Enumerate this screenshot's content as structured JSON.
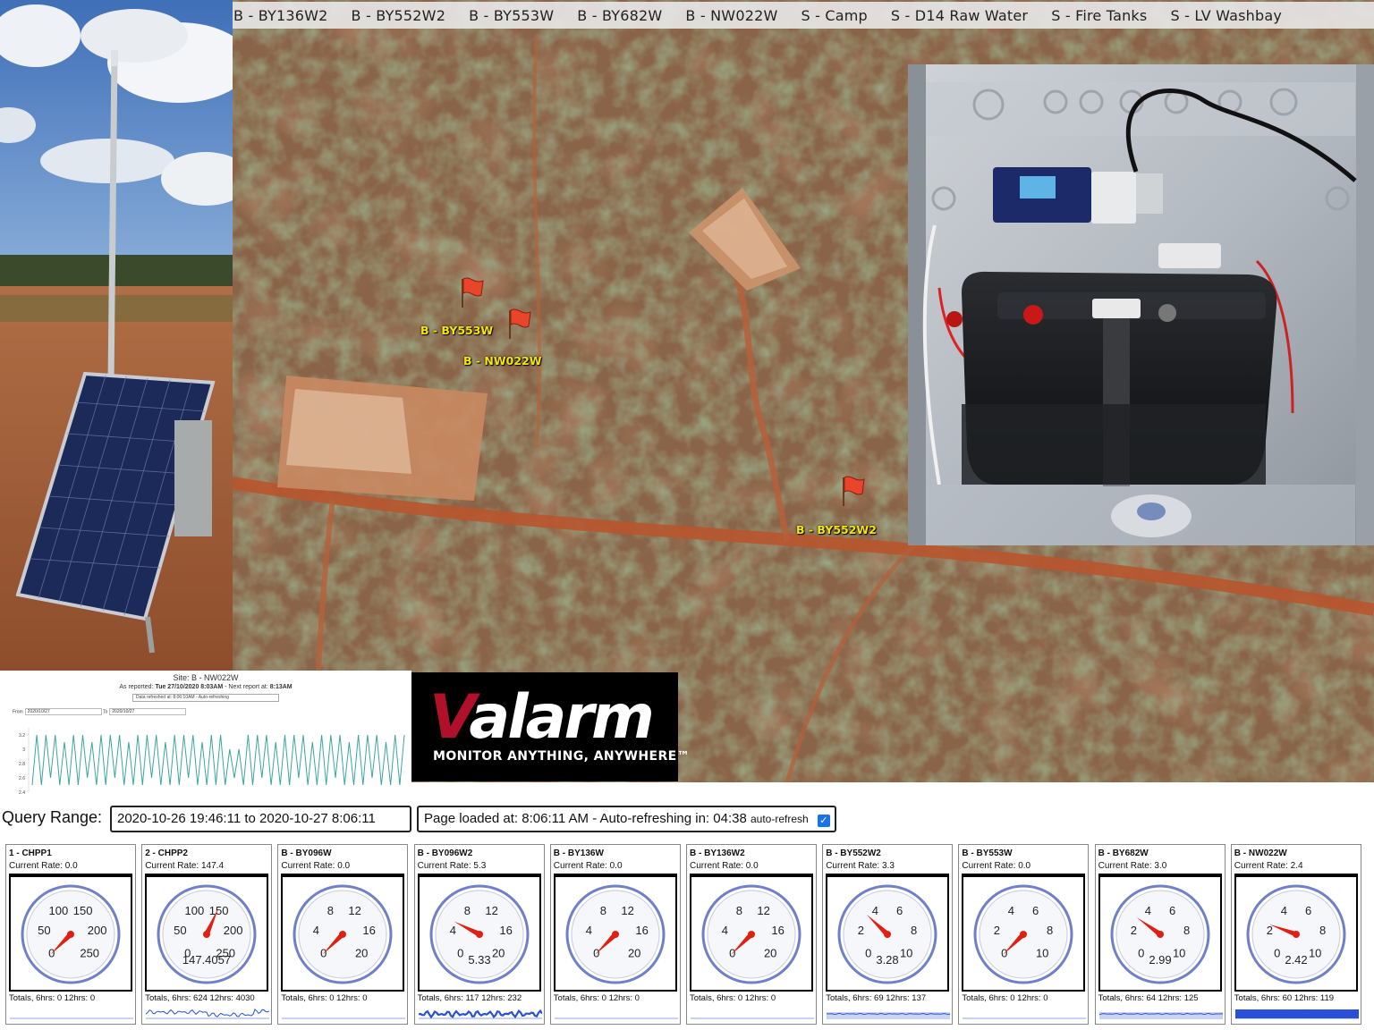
{
  "tabs": [
    "B - BY136W2",
    "B - BY552W2",
    "B - BY553W",
    "B - BY682W",
    "B - NW022W",
    "S - Camp",
    "S - D14 Raw Water",
    "S - Fire Tanks",
    "S - LV Washbay"
  ],
  "map_markers": [
    {
      "label": "B - BY553W"
    },
    {
      "label": "B - NW022W"
    },
    {
      "label": "B - BY552W2"
    }
  ],
  "detail_chart": {
    "site_title": "Site: B - NW022W",
    "reported_prefix": "As reported: ",
    "reported_at": "Tue 27/10/2020 8:03AM",
    "next_prefix": " - Next report at: ",
    "next_at": "8:13AM",
    "refresh_text": "Data refreshed at: 8:06:10AM - Auto-refreshing",
    "from_label": "From",
    "from_value": "2020/10/27",
    "to_label": "To",
    "to_value": "2020/10/27",
    "chart_data": {
      "type": "line",
      "ylim": [
        2.4,
        3.3
      ],
      "y_ticks": [
        "3.2",
        "3",
        "2.8",
        "2.6",
        "2.4"
      ],
      "series": [
        {
          "values": [
            2.5,
            3.2,
            2.5,
            3.2,
            2.6,
            3.2,
            2.5,
            3.1,
            2.5,
            3.2,
            2.5,
            3.2,
            2.6,
            3.1,
            2.5,
            3.2,
            2.5,
            3.2,
            2.6,
            3.2,
            2.5,
            3.1,
            2.5,
            3.2,
            2.5,
            3.2,
            2.6,
            3.2,
            2.5,
            3.1,
            2.5,
            3.2,
            2.5,
            3.2,
            2.6,
            3.2,
            2.5,
            3.1,
            2.5,
            3.2,
            2.5,
            3.2,
            2.5,
            3.0,
            2.6,
            3.0,
            2.5,
            3.2,
            2.5,
            3.2,
            2.6,
            3.2,
            2.5,
            3.1,
            2.5,
            3.2,
            2.5,
            3.2,
            2.6,
            3.2,
            2.5,
            3.1,
            2.5,
            3.2,
            2.5,
            3.2,
            2.6,
            3.2,
            2.5,
            3.1,
            2.5,
            3.2,
            2.5,
            3.2,
            2.6,
            3.2,
            2.5,
            3.1,
            2.5,
            3.2,
            2.5,
            3.2
          ]
        }
      ]
    }
  },
  "logo": {
    "v": "V",
    "rest": "alarm",
    "tagline": "MONITOR ANYTHING, ANYWHERE™"
  },
  "query": {
    "label": "Query Range:",
    "range": "2020-10-26 19:46:11 to 2020-10-27 8:06:11",
    "loaded": "Page loaded at: 8:06:11 AM - Auto-refreshing in: 04:38",
    "auto_refresh_label": "auto-refresh",
    "auto_refresh_checked": true
  },
  "colors": {
    "needle": "#e02010",
    "gauge_ring": "#7080c8",
    "spark": "#2a4fd8",
    "marker_flag": "#e8452a",
    "marker_label": "#f5e60a"
  },
  "gauges": [
    {
      "title": "1 - CHPP1",
      "rate": "Current Rate: 0.0",
      "ticks": [
        "0",
        "50",
        "100",
        "150",
        "200",
        "250"
      ],
      "max": 250,
      "value": 0,
      "readout": "",
      "totals": "Totals, 6hrs: 0 12hrs: 0",
      "spark": "flat"
    },
    {
      "title": "2 - CHPP2",
      "rate": "Current Rate: 147.4",
      "ticks": [
        "0",
        "50",
        "100",
        "150",
        "200",
        "250"
      ],
      "max": 250,
      "value": 147.4057,
      "readout": "147.4057",
      "totals": "Totals, 6hrs: 624 12hrs: 4030",
      "spark": "noisy"
    },
    {
      "title": "B - BY096W",
      "rate": "Current Rate: 0.0",
      "ticks": [
        "0",
        "4",
        "8",
        "12",
        "16",
        "20"
      ],
      "max": 20,
      "value": 0,
      "readout": "",
      "totals": "Totals, 6hrs: 0 12hrs: 0",
      "spark": "flat"
    },
    {
      "title": "B - BY096W2",
      "rate": "Current Rate: 5.3",
      "ticks": [
        "0",
        "4",
        "8",
        "12",
        "16",
        "20"
      ],
      "max": 20,
      "value": 5.33,
      "readout": "5.33",
      "totals": "Totals, 6hrs: 117 12hrs: 232",
      "spark": "dense"
    },
    {
      "title": "B - BY136W",
      "rate": "Current Rate: 0.0",
      "ticks": [
        "0",
        "4",
        "8",
        "12",
        "16",
        "20"
      ],
      "max": 20,
      "value": 0,
      "readout": "",
      "totals": "Totals, 6hrs: 0 12hrs: 0",
      "spark": "flat"
    },
    {
      "title": "B - BY136W2",
      "rate": "Current Rate: 0.0",
      "ticks": [
        "0",
        "4",
        "8",
        "12",
        "16",
        "20"
      ],
      "max": 20,
      "value": 0,
      "readout": "",
      "totals": "Totals, 6hrs: 0 12hrs: 0",
      "spark": "flat"
    },
    {
      "title": "B - BY552W2",
      "rate": "Current Rate: 3.3",
      "ticks": [
        "0",
        "2",
        "4",
        "6",
        "8",
        "10"
      ],
      "max": 10,
      "value": 3.28,
      "readout": "3.28",
      "totals": "Totals, 6hrs: 69 12hrs: 137",
      "spark": "band"
    },
    {
      "title": "B - BY553W",
      "rate": "Current Rate: 0.0",
      "ticks": [
        "0",
        "2",
        "4",
        "6",
        "8",
        "10"
      ],
      "max": 10,
      "value": 0,
      "readout": "",
      "totals": "Totals, 6hrs: 0 12hrs: 0",
      "spark": "flat"
    },
    {
      "title": "B - BY682W",
      "rate": "Current Rate: 3.0",
      "ticks": [
        "0",
        "2",
        "4",
        "6",
        "8",
        "10"
      ],
      "max": 10,
      "value": 2.99,
      "readout": "2.99",
      "totals": "Totals, 6hrs: 64 12hrs: 125",
      "spark": "band"
    },
    {
      "title": "B - NW022W",
      "rate": "Current Rate: 2.4",
      "ticks": [
        "0",
        "2",
        "4",
        "6",
        "8",
        "10"
      ],
      "max": 10,
      "value": 2.42,
      "readout": "2.42",
      "totals": "Totals, 6hrs: 60 12hrs: 119",
      "spark": "solid"
    }
  ]
}
